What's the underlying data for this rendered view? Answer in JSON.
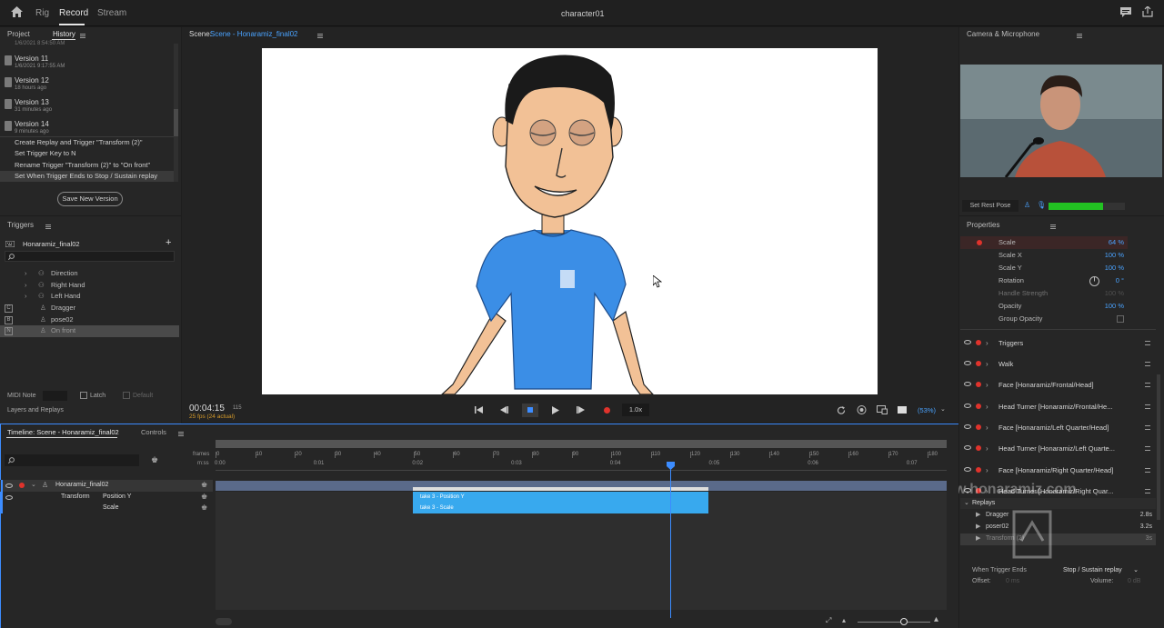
{
  "topbar": {
    "modes": [
      "Rig",
      "Record",
      "Stream"
    ],
    "title": "character01"
  },
  "left": {
    "tabs": [
      "Project",
      "History"
    ],
    "history_top_cut": "1/6/2021 8:54:50 AM",
    "versions": [
      {
        "name": "Version 11",
        "sub": "1/6/2021 9:17:55 AM"
      },
      {
        "name": "Version 12",
        "sub": "18 hours ago"
      },
      {
        "name": "Version 13",
        "sub": "31 minutes ago"
      },
      {
        "name": "Version 14",
        "sub": "9 minutes ago"
      }
    ],
    "history": [
      "Create Replay and Trigger \"Transform (2)\"",
      "Set Trigger Key to N",
      "Rename Trigger \"Transform (2)\" to \"On front\"",
      "Set When Trigger Ends to Stop / Sustain replay"
    ],
    "save_btn": "Save New Version",
    "triggers_hdr": "Triggers",
    "puppet": "Honaramiz_final02",
    "trigger_items": [
      {
        "key": "",
        "label": "Direction"
      },
      {
        "key": "",
        "label": "Right Hand"
      },
      {
        "key": "",
        "label": "Left Hand"
      },
      {
        "key": "C",
        "label": "Dragger"
      },
      {
        "key": "B",
        "label": "pose02"
      },
      {
        "key": "N",
        "label": "On front"
      }
    ],
    "midi": "MIDI Note",
    "latch": "Latch",
    "default": "Default",
    "layers": "Layers and Replays"
  },
  "scene": {
    "label": "Scene:",
    "name": "Scene - Honaramiz_final02",
    "time": "00:04:15",
    "frame": "115",
    "fps": "25 fps (24 actual)",
    "speed": "1.0x",
    "zoom": "(53%)"
  },
  "right": {
    "cam_hdr": "Camera & Microphone",
    "rest": "Set Rest Pose",
    "props_hdr": "Properties",
    "props": [
      {
        "label": "Scale",
        "value": "64",
        "unit": "%"
      },
      {
        "label": "Scale X",
        "value": "100",
        "unit": "%"
      },
      {
        "label": "Scale Y",
        "value": "100",
        "unit": "%"
      },
      {
        "label": "Rotation",
        "value": "0",
        "unit": "°"
      },
      {
        "label": "Handle Strength",
        "value": "100",
        "unit": "%"
      },
      {
        "label": "Opacity",
        "value": "100",
        "unit": "%"
      },
      {
        "label": "Group Opacity",
        "value": "",
        "unit": ""
      }
    ],
    "layers": [
      "Triggers",
      "Walk",
      "Face [Honaramiz/Frontal/Head]",
      "Head Turner [Honaramiz/Frontal/He...",
      "Face [Honaramiz/Left Quarter/Head]",
      "Head Turner [Honaramiz/Left Quarte...",
      "Face [Honaramiz/Right Quarter/Head]",
      "Head Turner [Honaramiz/Right Quar..."
    ],
    "replays_hdr": "Replays",
    "replays": [
      {
        "name": "Dragger",
        "dur": "2.8s"
      },
      {
        "name": "poser02",
        "dur": "3.2s"
      },
      {
        "name": "Transform (2)",
        "dur": "3s"
      }
    ],
    "when_ends": "When Trigger Ends",
    "when_val": "Stop / Sustain replay",
    "offset": "Offset:",
    "offset_val": "0 ms",
    "volume": "Volume:",
    "volume_val": "0 dB",
    "watermark": "www.honaramiz.com"
  },
  "timeline": {
    "tab": "Timeline: Scene - Honaramiz_final02",
    "tab2": "Controls",
    "frames_lbl": "frames",
    "mss_lbl": "m:ss",
    "frames": [
      "0",
      "10",
      "20",
      "30",
      "40",
      "50",
      "60",
      "70",
      "80",
      "90",
      "100",
      "110",
      "120",
      "130",
      "140",
      "150",
      "160",
      "170",
      "180"
    ],
    "secs": [
      "0:00",
      "0:01",
      "0:02",
      "0:03",
      "0:04",
      "0:05",
      "0:06",
      "0:07"
    ],
    "puppet": "Honaramiz_final02",
    "transform": "Transform",
    "pos_y": "Position Y",
    "scale": "Scale",
    "take1": "take 3 - Position Y",
    "take2": "take 3 - Scale"
  },
  "colors": {
    "accent": "#38a9ee",
    "record": "#e0332c"
  }
}
